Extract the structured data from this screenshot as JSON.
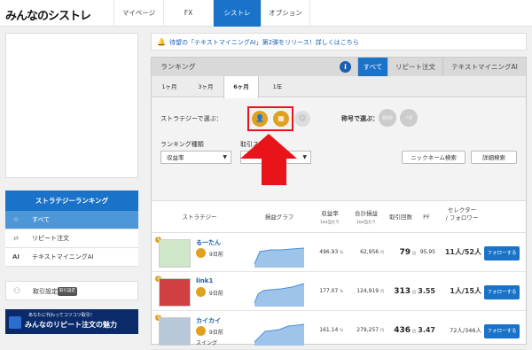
{
  "logo": "みんなのシストレ",
  "nav": [
    "マイページ",
    "FX",
    "シストレ",
    "オプション"
  ],
  "notice": "待望の「テキストマイニングAI」第2弾をリリース！詳しくはこちら",
  "sidebar": {
    "heading": "ストラテジーランキング",
    "items": [
      {
        "icon": "☆",
        "label": "すべて"
      },
      {
        "icon": "⇄",
        "label": "リピート注文"
      },
      {
        "icon": "AI",
        "label": "テキストマイニングAI"
      }
    ],
    "settings": "取引設定",
    "settings_badge": "取引設定",
    "banner_small": "あなたに代わってコツコツ取引！",
    "banner_main": "みんなのリピート注文の魅力"
  },
  "ranking": {
    "title": "ランキング",
    "tabs": [
      "すべて",
      "リピート注文",
      "テキストマイニングAI"
    ],
    "periods": [
      "1ヶ月",
      "3ヶ月",
      "6ヶ月",
      "1年"
    ],
    "strategy_label": "ストラテジーで選ぶ：",
    "title_label": "称号で選ぶ：",
    "badge1": "高収益",
    "badge2": "人気",
    "kind_label": "ランキング種類",
    "kind_value": "収益率",
    "trade_label": "取引スタイル",
    "nickname_btn": "ニックネーム検索",
    "detail_btn": "詳細検索"
  },
  "table": {
    "headers": {
      "strategy": "ストラテジー",
      "graph": "損益グラフ",
      "rate": "収益率",
      "rate_sub": "1lot当たり",
      "total": "合計損益",
      "total_sub": "1lot当たり",
      "count": "取引回数",
      "pf": "PF",
      "selector": "セレクター",
      "follower": "/ フォロワー"
    },
    "rows": [
      {
        "rank": "1",
        "name": "る一たん",
        "ago": "9日前",
        "tag": "",
        "rate": "496.93",
        "total": "62,956",
        "count": "79",
        "pf": "95.95",
        "sel": "11人/52人"
      },
      {
        "rank": "2",
        "name": "link1",
        "ago": "9日前",
        "tag": "",
        "rate": "177.07",
        "total": "124,919",
        "count": "313",
        "pf": "3.55",
        "sel": "1人/15人"
      },
      {
        "rank": "3",
        "name": "カイカイ",
        "ago": "9日前",
        "tag": "スイング",
        "rate": "161.14",
        "total": "279,257",
        "count": "436",
        "pf": "3.47",
        "sel": "72人/346人"
      }
    ],
    "follow_label": "フォローする",
    "percent_unit": "%",
    "yen_unit": "円",
    "count_unit": "回"
  }
}
